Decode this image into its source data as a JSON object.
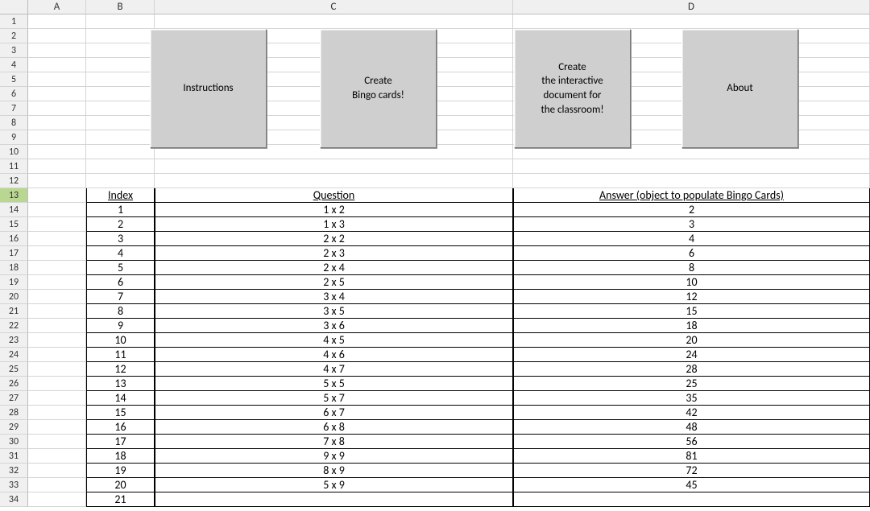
{
  "columns": [
    "A",
    "B",
    "C",
    "D"
  ],
  "rowCount": 34,
  "selectedRow": 13,
  "buttons": {
    "b0": "Instructions",
    "b1": "Create\nBingo cards!",
    "b2": "Create\nthe interactive\ndocument for\nthe classroom!",
    "b3": "About"
  },
  "headers": {
    "index": "Index",
    "question": "Question",
    "answer": "Answer (object to populate Bingo Cards)"
  },
  "rows": [
    {
      "idx": "1",
      "q": "1 x 2",
      "a": "2"
    },
    {
      "idx": "2",
      "q": "1 x 3",
      "a": "3"
    },
    {
      "idx": "3",
      "q": "2 x 2",
      "a": "4"
    },
    {
      "idx": "4",
      "q": "2 x 3",
      "a": "6"
    },
    {
      "idx": "5",
      "q": "2 x 4",
      "a": "8"
    },
    {
      "idx": "6",
      "q": "2 x 5",
      "a": "10"
    },
    {
      "idx": "7",
      "q": "3 x 4",
      "a": "12"
    },
    {
      "idx": "8",
      "q": "3 x 5",
      "a": "15"
    },
    {
      "idx": "9",
      "q": "3 x 6",
      "a": "18"
    },
    {
      "idx": "10",
      "q": "4 x 5",
      "a": "20"
    },
    {
      "idx": "11",
      "q": "4 x 6",
      "a": "24"
    },
    {
      "idx": "12",
      "q": "4 x 7",
      "a": "28"
    },
    {
      "idx": "13",
      "q": "5 x 5",
      "a": "25"
    },
    {
      "idx": "14",
      "q": "5 x 7",
      "a": "35"
    },
    {
      "idx": "15",
      "q": "6 x 7",
      "a": "42"
    },
    {
      "idx": "16",
      "q": "6 x 8",
      "a": "48"
    },
    {
      "idx": "17",
      "q": "7 x 8",
      "a": "56"
    },
    {
      "idx": "18",
      "q": "9 x 9",
      "a": "81"
    },
    {
      "idx": "19",
      "q": "8 x 9",
      "a": "72"
    },
    {
      "idx": "20",
      "q": "5 x 9",
      "a": "45"
    },
    {
      "idx": "21",
      "q": "",
      "a": ""
    }
  ]
}
